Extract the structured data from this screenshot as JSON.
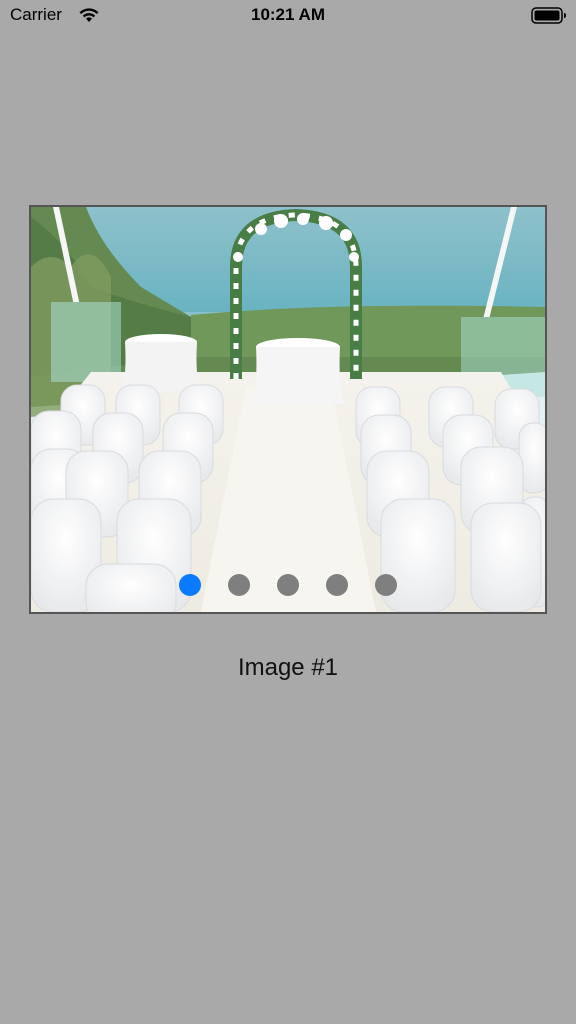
{
  "status_bar": {
    "carrier": "Carrier",
    "time": "10:21 AM",
    "icons": [
      "wifi-icon",
      "battery-icon"
    ]
  },
  "carousel": {
    "image_description": "wedding ceremony setup with floral arch by the sea",
    "page_count": 5,
    "current_page": 1,
    "active_dot_color": "#0a7aff",
    "inactive_dot_color": "#7f7f7f"
  },
  "caption": {
    "text": "Image #1"
  },
  "colors": {
    "background": "#a9a9a9"
  }
}
